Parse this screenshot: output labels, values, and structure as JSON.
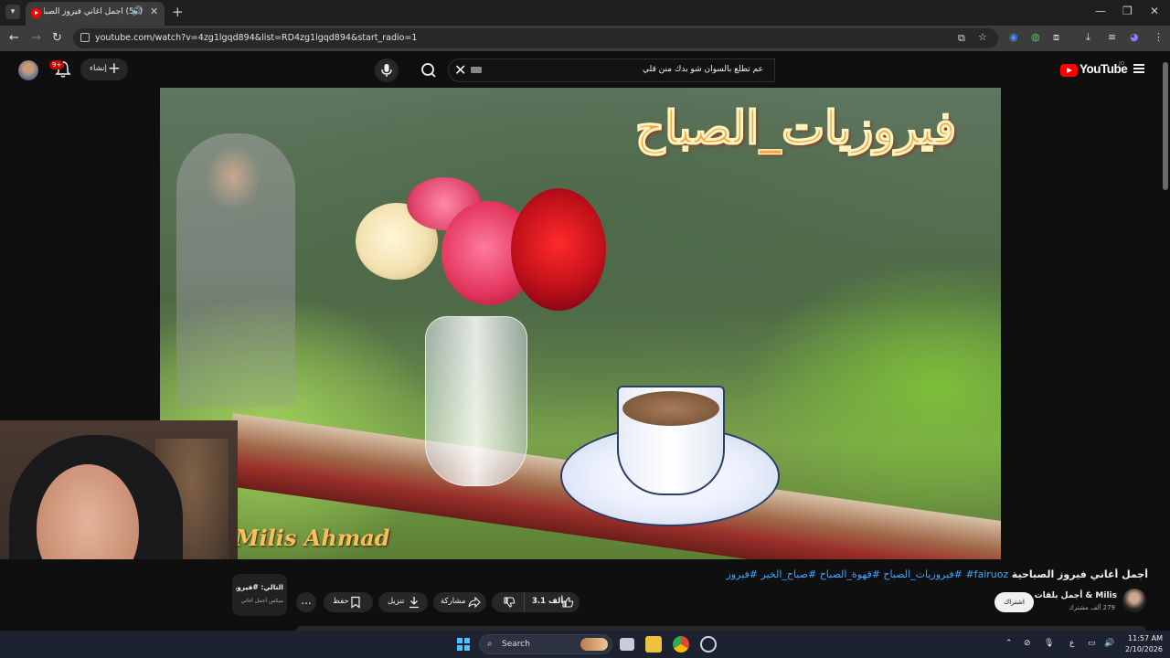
{
  "browser": {
    "tab_title": "(51) أجمل أغاني فيروز الصبا",
    "url": "youtube.com/watch?v=4zg1lgqd894&list=RD4zg1lgqd894&start_radio=1"
  },
  "youtube": {
    "logo_text": "YouTube",
    "logo_region": "JO",
    "notifications_badge": "9+",
    "create_label": "إنشاء",
    "search_query": "عم تطلع بالسوان شو بدك منن قلي"
  },
  "video": {
    "overlay_title": "فيروزيات_الصباح",
    "watermark": "Milis Ahmad",
    "title_main": "أجمل أغاني فيروز الصباحية",
    "title_tags": " fairuoz# #فيروزيات_الصباح #قهوة_الصباح #صباح_الخير #فيروز"
  },
  "channel": {
    "name": "Milis & أجمل بلقات",
    "subscribers": "279 ألف مشترك",
    "subscribe_label": "اشتراك"
  },
  "actions": {
    "likes": "3.1 ألف",
    "share_label": "مشاركة",
    "download_label": "تنزيل",
    "save_label": "حفظ",
    "more_label": "..."
  },
  "info_card": {
    "title": "التالي: #فيروز",
    "subtitle": "ميكس أجمل أغاني"
  },
  "taskbar": {
    "search_label": "Search",
    "lang": "ع",
    "time": "11:57 AM",
    "date": "2/10/2026"
  }
}
